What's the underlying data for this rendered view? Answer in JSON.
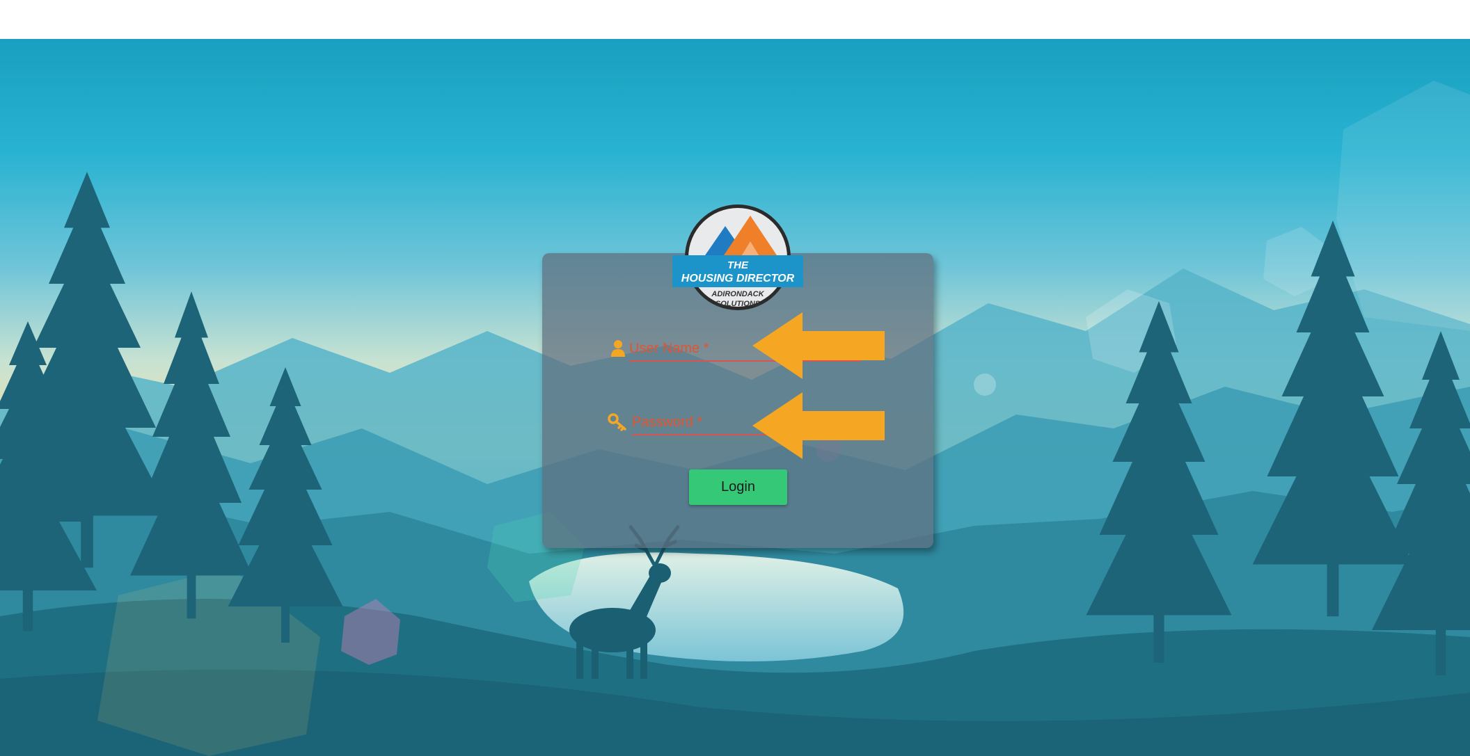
{
  "logo": {
    "line1": "THE",
    "line2": "HOUSING DIRECTOR",
    "line3": "ADIRONDACK",
    "line4": "SOLUTIONS"
  },
  "form": {
    "username": {
      "placeholder": "User Name *",
      "value": "",
      "icon": "user-icon"
    },
    "password": {
      "placeholder": "Password *",
      "value": "",
      "icon": "key-icon"
    },
    "login_label": "Login"
  },
  "annotations": {
    "arrows": [
      "arrow-pointing-left",
      "arrow-pointing-left"
    ]
  },
  "colors": {
    "accent_orange": "#f5a623",
    "button_green": "#35c977",
    "placeholder_red": "#e4532f",
    "sky_top": "#1fa8c8",
    "sky_horizon": "#f2e2a8"
  }
}
